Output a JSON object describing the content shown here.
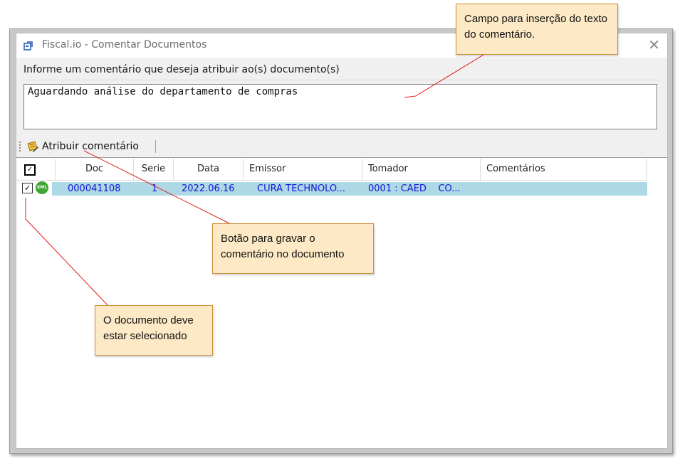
{
  "window": {
    "title": "Fiscal.io - Comentar Documentos",
    "close_glyph": "✕"
  },
  "form": {
    "prompt_label": "Informe um comentário que deseja atribuir ao(s) documento(s)",
    "comment_value": "Aguardando análise do departamento de compras"
  },
  "toolbar": {
    "assign_label": "Atribuir comentário",
    "assign_icon": "note-pencil-icon"
  },
  "grid": {
    "columns": [
      "Doc",
      "Serie",
      "Data",
      "Emissor",
      "Tomador",
      "Comentários"
    ],
    "rows": [
      {
        "checked": true,
        "type_badge": "XML",
        "doc": "000041108",
        "serie": "1",
        "data": "2022.06.16",
        "emissor": "CURA TECHNOLO...",
        "tomador": "0001 : CAED    CO...",
        "comentarios": ""
      }
    ]
  },
  "callouts": {
    "comment_field": "Campo para inserção do texto do comentário.",
    "save_button": "Botão para gravar o comentário no documento",
    "selection": "O documento deve estar selecionado"
  },
  "colors": {
    "selected_row": "#add8e6",
    "row_text": "#1515d6",
    "callout_bg": "#fde9c5",
    "callout_border": "#cc8e35",
    "annotation_line": "#e31919",
    "xml_badge": "#3fa535"
  }
}
